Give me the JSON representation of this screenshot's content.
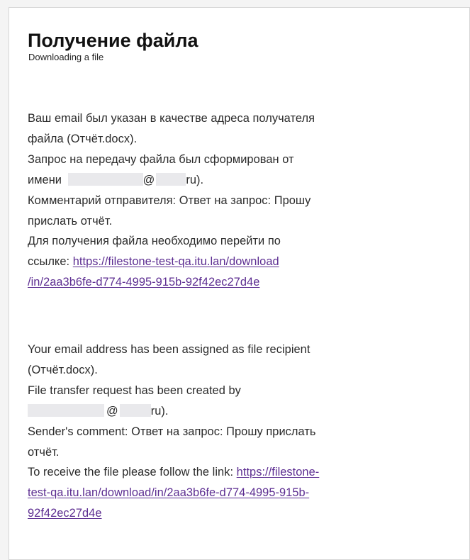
{
  "header": {
    "title": "Получение файла",
    "subtitle": "Downloading a file"
  },
  "ru": {
    "line1": "Ваш email был указан в качестве адреса получателя",
    "line2": "файла (Отчёт.docx).",
    "line3": "Запрос на передачу файла был сформирован от",
    "line4_prefix": "имени",
    "line4_at": "@",
    "line4_suffix": "ru).",
    "line5": "Комментарий отправителя: Ответ на запрос: Прошу",
    "line6": "прислать отчёт.",
    "line7": "Для получения файла необходимо перейти по",
    "line8_prefix": "ссылке:",
    "link_part1": "https://filestone-test-qa.itu.lan/download",
    "link_part2": "/in/2aa3b6fe-d774-4995-915b-92f42ec27d4e"
  },
  "en": {
    "line1": "Your email address has been assigned as file recipient",
    "line2": "(Отчёт.docx).",
    "line3": "File transfer request has been created by",
    "line4_at": "@",
    "line4_suffix": "ru).",
    "line5": "Sender's comment: Ответ на запрос: Прошу прислать",
    "line6": "отчёт.",
    "line7_prefix": "To receive the file please follow the link:",
    "link_part1": "https://filestone-",
    "link_part2": "test-qa.itu.lan/download/in/2aa3b6fe-d774-4995-915b-",
    "link_part3": "92f42ec27d4e"
  },
  "colors": {
    "link": "#5c2d91",
    "redaction": "#e9e9ec"
  }
}
